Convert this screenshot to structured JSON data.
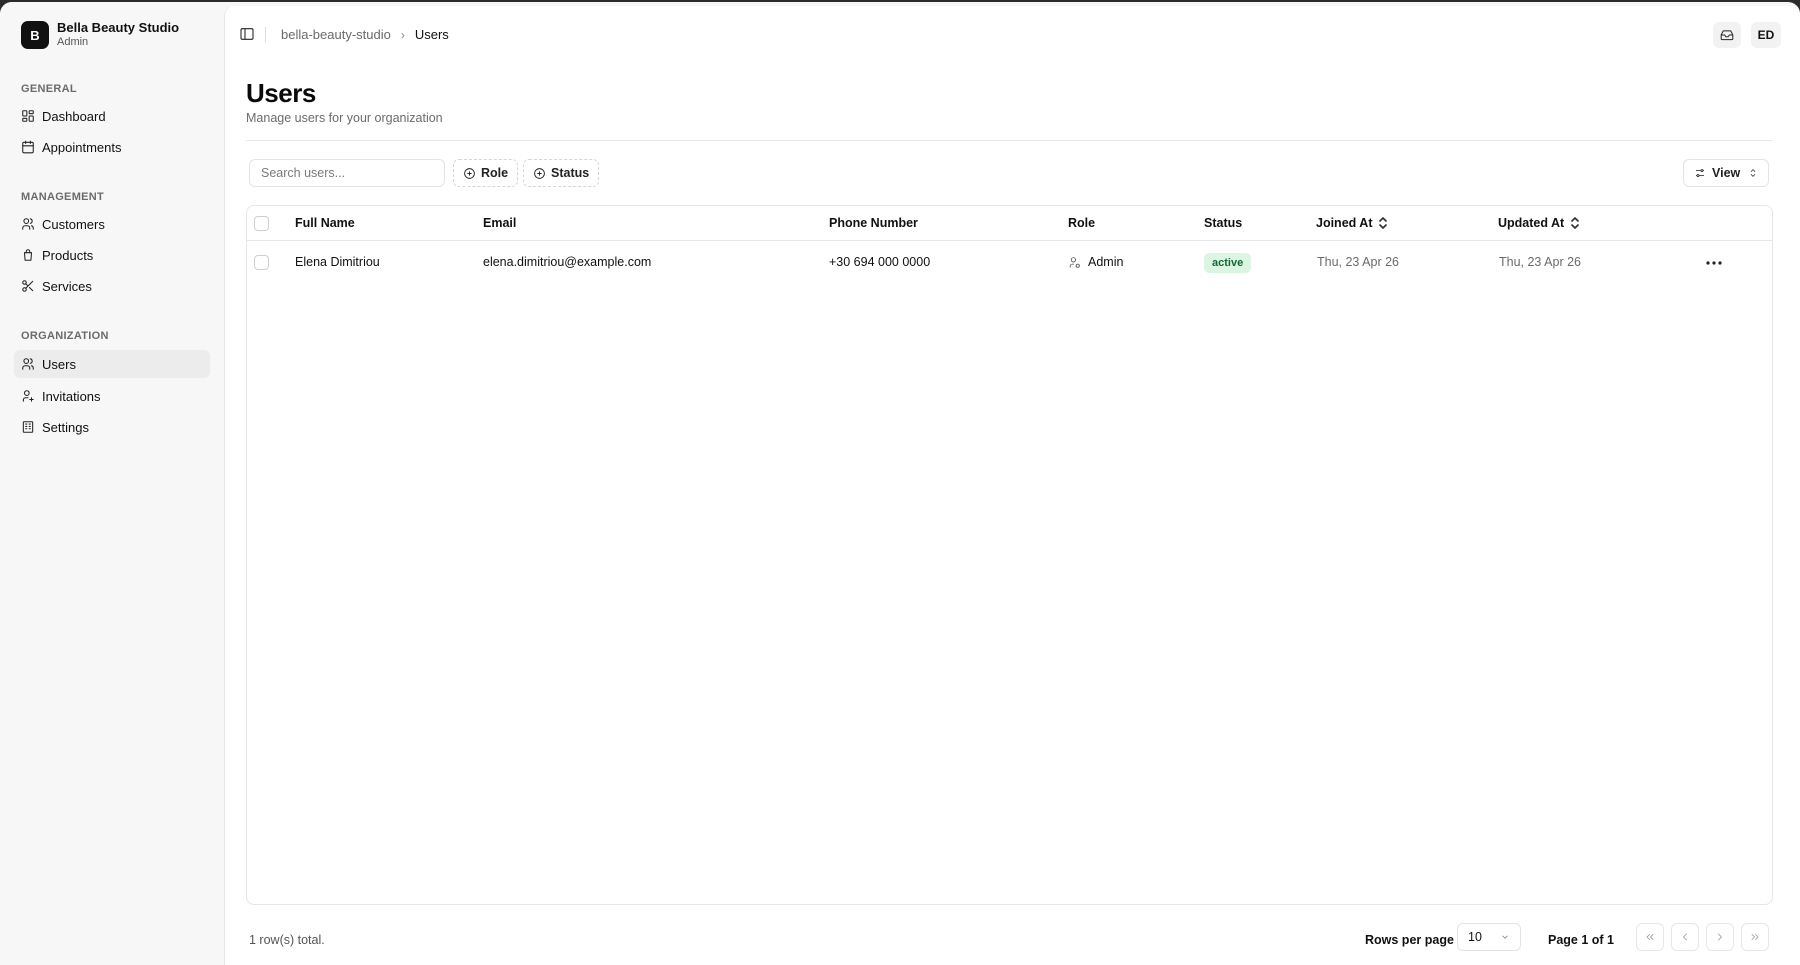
{
  "sidebar": {
    "brand": {
      "initial": "B",
      "name": "Bella Beauty Studio",
      "role": "Admin"
    },
    "groups": [
      {
        "label": "GENERAL",
        "items": [
          {
            "label": "Dashboard",
            "icon": "grid-icon"
          },
          {
            "label": "Appointments",
            "icon": "calendar-icon"
          }
        ]
      },
      {
        "label": "MANAGEMENT",
        "items": [
          {
            "label": "Customers",
            "icon": "users-icon"
          },
          {
            "label": "Products",
            "icon": "shopping-bag-icon"
          },
          {
            "label": "Services",
            "icon": "scissors-icon"
          }
        ]
      },
      {
        "label": "ORGANIZATION",
        "items": [
          {
            "label": "Users",
            "icon": "users-icon",
            "active": true
          },
          {
            "label": "Invitations",
            "icon": "user-plus-icon"
          },
          {
            "label": "Settings",
            "icon": "building-icon"
          }
        ]
      }
    ]
  },
  "header": {
    "breadcrumb": {
      "org": "bella-beauty-studio",
      "current": "Users"
    },
    "avatar_initials": "ED"
  },
  "page": {
    "title": "Users",
    "subtitle": "Manage users for your organization"
  },
  "toolbar": {
    "search_placeholder": "Search users...",
    "filter_role": "Role",
    "filter_status": "Status",
    "view_label": "View"
  },
  "table": {
    "columns": {
      "full_name": "Full Name",
      "email": "Email",
      "phone": "Phone Number",
      "role": "Role",
      "status": "Status",
      "joined_at": "Joined At",
      "updated_at": "Updated At"
    },
    "rows": [
      {
        "full_name": "Elena Dimitriou",
        "email": "elena.dimitriou@example.com",
        "phone": "+30 694 000 0000",
        "role": "Admin",
        "status": "active",
        "joined_at": "Thu, 23 Apr 26",
        "updated_at": "Thu, 23 Apr 26"
      }
    ]
  },
  "footer": {
    "total": "1 row(s) total.",
    "rows_per_page_label": "Rows per page",
    "rows_per_page_value": "10",
    "page_info": "Page 1 of 1"
  },
  "colors": {
    "accent": "#111111",
    "status_active_bg": "#dcf5e3",
    "status_active_text": "#166534"
  }
}
